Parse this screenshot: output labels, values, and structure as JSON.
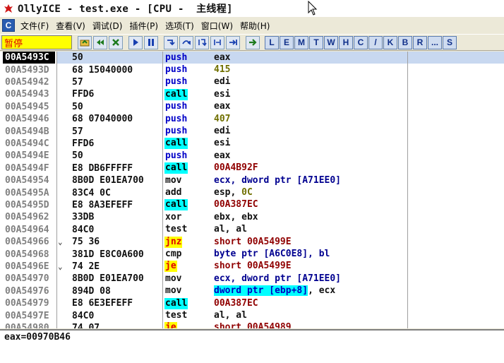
{
  "window": {
    "title": "OllyICE - test.exe - [CPU -  主线程]"
  },
  "menu": {
    "items": [
      "文件(F)",
      "查看(V)",
      "调试(D)",
      "插件(P)",
      "选项(T)",
      "窗口(W)",
      "帮助(H)"
    ]
  },
  "toolbar": {
    "status": "暂停",
    "letter_buttons": [
      "L",
      "E",
      "M",
      "T",
      "W",
      "H",
      "C",
      "/",
      "K",
      "B",
      "R",
      "...",
      "S"
    ]
  },
  "disassembly": {
    "rows": [
      {
        "addr": "00A5493C",
        "hex": "50",
        "mnem": "push",
        "ops": "eax",
        "style": "push",
        "selected": true
      },
      {
        "addr": "00A5493D",
        "hex": "68 15040000",
        "mnem": "push",
        "ops": "415",
        "style": "push",
        "ops_style": "num"
      },
      {
        "addr": "00A54942",
        "hex": "57",
        "mnem": "push",
        "ops": "edi",
        "style": "push"
      },
      {
        "addr": "00A54943",
        "hex": "FFD6",
        "mnem": "call",
        "ops": "esi",
        "style": "call"
      },
      {
        "addr": "00A54945",
        "hex": "50",
        "mnem": "push",
        "ops": "eax",
        "style": "push"
      },
      {
        "addr": "00A54946",
        "hex": "68 07040000",
        "mnem": "push",
        "ops": "407",
        "style": "push",
        "ops_style": "num"
      },
      {
        "addr": "00A5494B",
        "hex": "57",
        "mnem": "push",
        "ops": "edi",
        "style": "push"
      },
      {
        "addr": "00A5494C",
        "hex": "FFD6",
        "mnem": "call",
        "ops": "esi",
        "style": "call"
      },
      {
        "addr": "00A5494E",
        "hex": "50",
        "mnem": "push",
        "ops": "eax",
        "style": "push"
      },
      {
        "addr": "00A5494F",
        "hex": "E8 DB6FFFFF",
        "mnem": "call",
        "ops": "00A4B92F",
        "style": "call",
        "ops_style": "red"
      },
      {
        "addr": "00A54954",
        "hex": "8B0D E01EA700",
        "mnem": "mov",
        "ops": "ecx, dword ptr [A71EE0]",
        "style": "plain",
        "ops_style": "blue"
      },
      {
        "addr": "00A5495A",
        "hex": "83C4 0C",
        "mnem": "add",
        "ops_pre": "esp, ",
        "ops": "0C",
        "style": "plain",
        "ops_style": "num"
      },
      {
        "addr": "00A5495D",
        "hex": "E8 8A3EFEFF",
        "mnem": "call",
        "ops": "00A387EC",
        "style": "call",
        "ops_style": "red"
      },
      {
        "addr": "00A54962",
        "hex": "33DB",
        "mnem": "xor",
        "ops": "ebx, ebx",
        "style": "plain"
      },
      {
        "addr": "00A54964",
        "hex": "84C0",
        "mnem": "test",
        "ops": "al, al",
        "style": "plain"
      },
      {
        "addr": "00A54966",
        "hex": "75 36",
        "mnem": "jnz",
        "ops": "short 00A5499E",
        "style": "jcc",
        "ops_style": "red",
        "jump_mark": "⌄"
      },
      {
        "addr": "00A54968",
        "hex": "381D E8C0A600",
        "mnem": "cmp",
        "ops": "byte ptr [A6C0E8], bl",
        "style": "plain",
        "ops_style": "blue"
      },
      {
        "addr": "00A5496E",
        "hex": "74 2E",
        "mnem": "je",
        "ops": "short 00A5499E",
        "style": "jcc",
        "ops_style": "red",
        "jump_mark": "⌄"
      },
      {
        "addr": "00A54970",
        "hex": "8B0D E01EA700",
        "mnem": "mov",
        "ops": "ecx, dword ptr [A71EE0]",
        "style": "plain",
        "ops_style": "blue"
      },
      {
        "addr": "00A54976",
        "hex": "894D 08",
        "mnem": "mov",
        "ops_hl": "dword ptr [ebp+8]",
        "ops_post": ", ecx",
        "style": "plain"
      },
      {
        "addr": "00A54979",
        "hex": "E8 6E3EFEFF",
        "mnem": "call",
        "ops": "00A387EC",
        "style": "call",
        "ops_style": "red"
      },
      {
        "addr": "00A5497E",
        "hex": "84C0",
        "mnem": "test",
        "ops": "al, al",
        "style": "plain"
      },
      {
        "addr": "00A54980",
        "hex": "74 07",
        "mnem": "je",
        "ops": "short 00A54989",
        "style": "jcc",
        "ops_style": "red"
      }
    ]
  },
  "info": {
    "line": "eax=00970B46"
  }
}
